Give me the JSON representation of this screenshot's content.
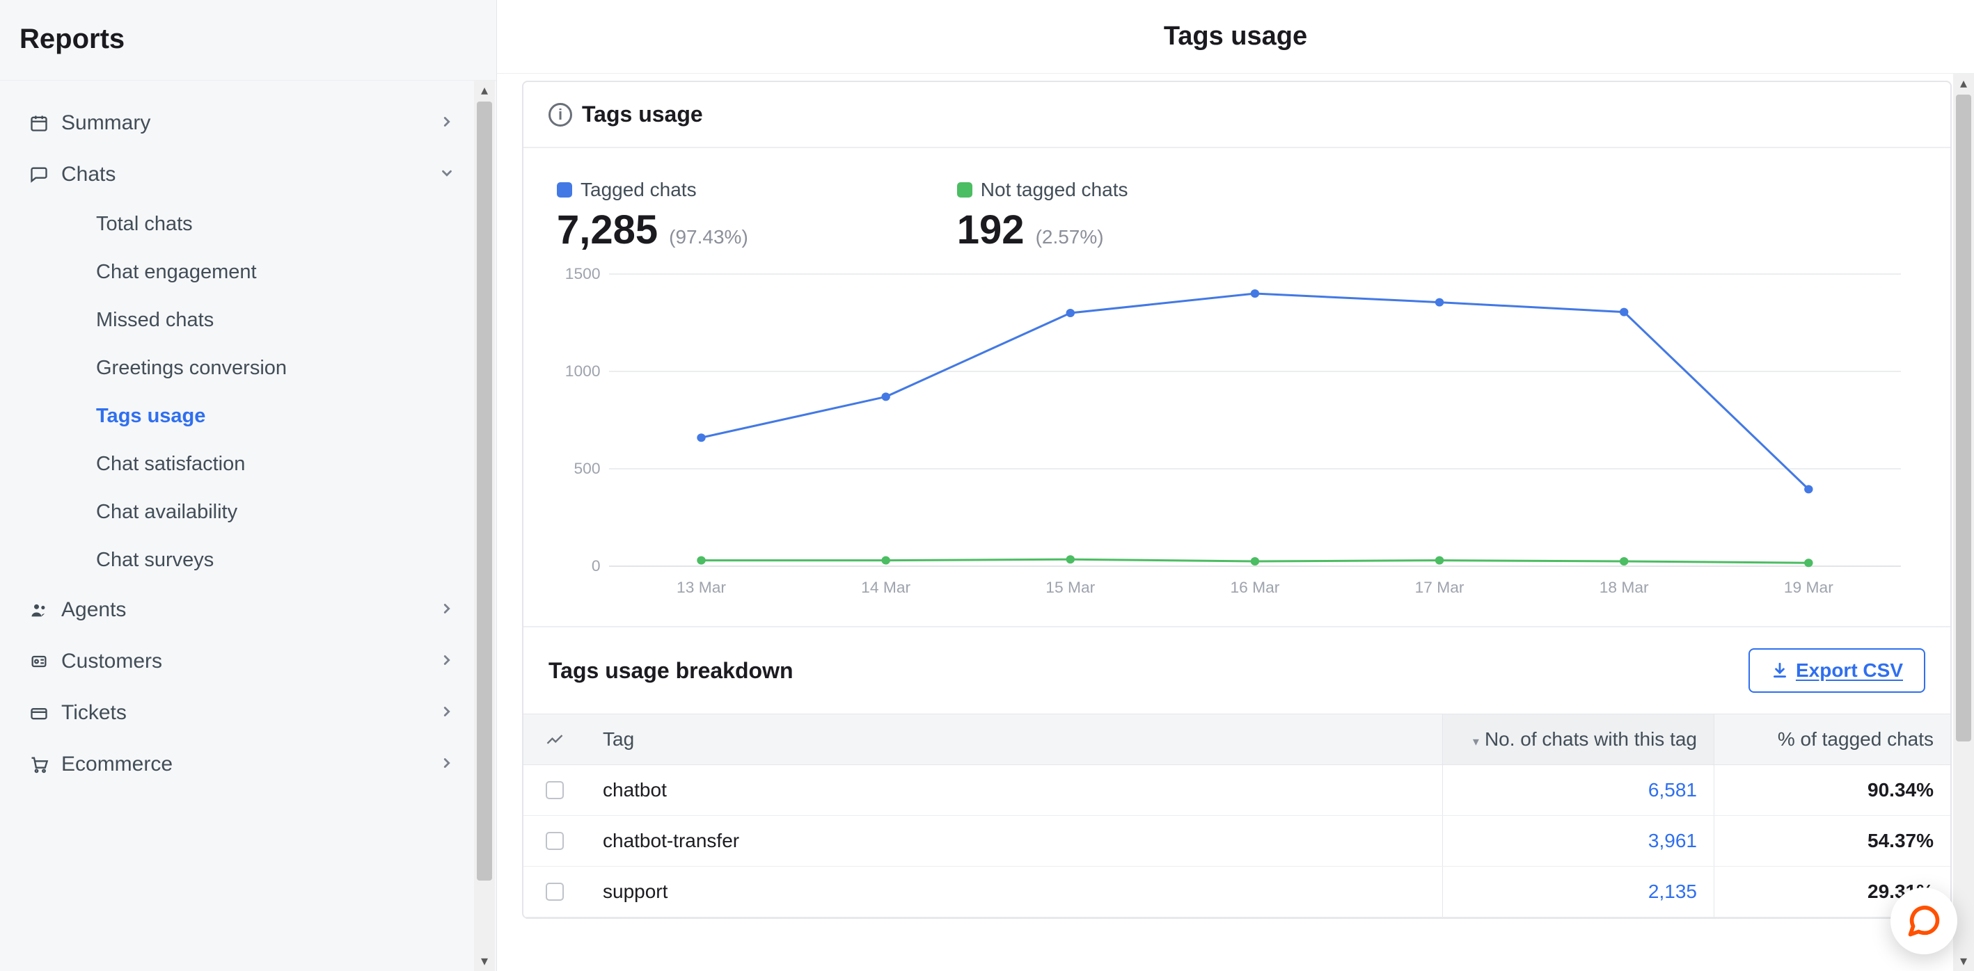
{
  "sidebar": {
    "title": "Reports",
    "items": [
      {
        "label": "Summary",
        "icon": "calendar",
        "expandable": true,
        "expanded": false
      },
      {
        "label": "Chats",
        "icon": "chat",
        "expandable": true,
        "expanded": true,
        "children": [
          {
            "label": "Total chats",
            "active": false
          },
          {
            "label": "Chat engagement",
            "active": false
          },
          {
            "label": "Missed chats",
            "active": false
          },
          {
            "label": "Greetings conversion",
            "active": false
          },
          {
            "label": "Tags usage",
            "active": true
          },
          {
            "label": "Chat satisfaction",
            "active": false
          },
          {
            "label": "Chat availability",
            "active": false
          },
          {
            "label": "Chat surveys",
            "active": false
          }
        ]
      },
      {
        "label": "Agents",
        "icon": "agents",
        "expandable": true,
        "expanded": false
      },
      {
        "label": "Customers",
        "icon": "customers",
        "expandable": true,
        "expanded": false
      },
      {
        "label": "Tickets",
        "icon": "tickets",
        "expandable": true,
        "expanded": false
      },
      {
        "label": "Ecommerce",
        "icon": "cart",
        "expandable": true,
        "expanded": false
      }
    ]
  },
  "page": {
    "title": "Tags usage"
  },
  "card": {
    "title": "Tags usage",
    "stats": {
      "tagged": {
        "label": "Tagged chats",
        "value": "7,285",
        "pct": "(97.43%)",
        "color": "#4379e4"
      },
      "not_tagged": {
        "label": "Not tagged chats",
        "value": "192",
        "pct": "(2.57%)",
        "color": "#4bbd62"
      }
    }
  },
  "chart_data": {
    "type": "line",
    "xlabel": "",
    "ylabel": "",
    "ylim": [
      0,
      1500
    ],
    "yticks": [
      0,
      500,
      1000,
      1500
    ],
    "categories": [
      "13 Mar",
      "14 Mar",
      "15 Mar",
      "16 Mar",
      "17 Mar",
      "18 Mar",
      "19 Mar"
    ],
    "series": [
      {
        "name": "Tagged chats",
        "color": "#4379e4",
        "values": [
          660,
          870,
          1300,
          1400,
          1355,
          1305,
          395
        ]
      },
      {
        "name": "Not tagged chats",
        "color": "#4bbd62",
        "values": [
          30,
          30,
          35,
          25,
          30,
          25,
          17
        ]
      }
    ]
  },
  "breakdown": {
    "title": "Tags usage breakdown",
    "export_label": "Export CSV",
    "columns": {
      "tag": "Tag",
      "count": "No. of chats with this tag",
      "pct": "% of tagged chats"
    },
    "sort": {
      "column": "count",
      "direction": "desc"
    },
    "rows": [
      {
        "tag": "chatbot",
        "count": "6,581",
        "pct": "90.34%"
      },
      {
        "tag": "chatbot-transfer",
        "count": "3,961",
        "pct": "54.37%"
      },
      {
        "tag": "support",
        "count": "2,135",
        "pct": "29.31%"
      }
    ]
  }
}
